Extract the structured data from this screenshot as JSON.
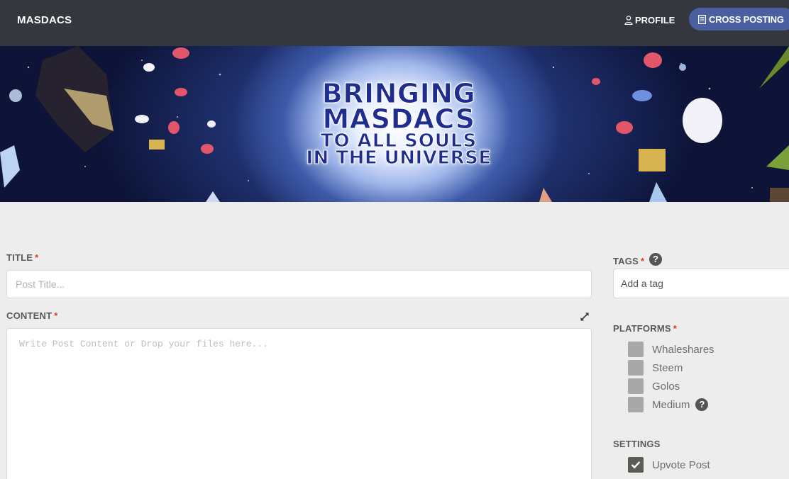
{
  "navbar": {
    "brand": "MASDACS",
    "profile_label": "PROFILE",
    "profile_icon": "user-icon",
    "cross_posting_label": "CROSS POSTING",
    "cross_posting_icon": "document-icon",
    "background_color": "#34373d",
    "accent_color": "#4a5fa0"
  },
  "banner": {
    "line1": "BRINGING",
    "line2": "MASDACS",
    "line3": "TO ALL SOULS",
    "line4": "IN THE UNIVERSE"
  },
  "form": {
    "title": {
      "label": "TITLE",
      "required_mark": "*",
      "placeholder": "Post Title..."
    },
    "content": {
      "label": "CONTENT",
      "required_mark": "*",
      "placeholder": "Write Post Content or Drop your files here...",
      "expand_icon": "expand-icon"
    }
  },
  "sidebar": {
    "tags": {
      "label": "TAGS",
      "required_mark": "*",
      "help": "?",
      "placeholder": "Add a tag"
    },
    "platforms": {
      "label": "PLATFORMS",
      "required_mark": "*",
      "items": [
        {
          "label": "Whaleshares",
          "checked": false
        },
        {
          "label": "Steem",
          "checked": false
        },
        {
          "label": "Golos",
          "checked": false
        },
        {
          "label": "Medium",
          "checked": false,
          "help": "?"
        }
      ]
    },
    "settings": {
      "label": "SETTINGS",
      "items": [
        {
          "label": "Upvote Post",
          "checked": true
        }
      ]
    }
  },
  "colors": {
    "required": "#d93c2b",
    "page_background": "#ededed",
    "checkbox_unchecked": "#a8a8a8",
    "checkbox_checked": "#5e5a56"
  }
}
